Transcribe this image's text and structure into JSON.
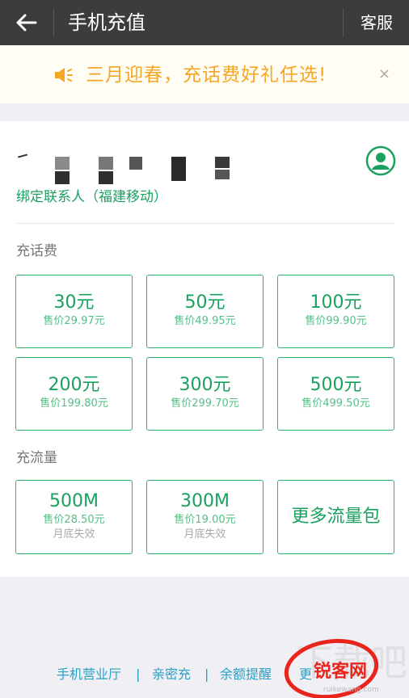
{
  "header": {
    "title": "手机充值",
    "service_label": "客服"
  },
  "notice": {
    "text": "三月迎春，充话费好礼任选!",
    "close": "×"
  },
  "contact": {
    "label": "绑定联系人（福建移动）"
  },
  "recharge": {
    "title": "充话费",
    "items": [
      {
        "amount": "30元",
        "price": "售价29.97元"
      },
      {
        "amount": "50元",
        "price": "售价49.95元"
      },
      {
        "amount": "100元",
        "price": "售价99.90元"
      },
      {
        "amount": "200元",
        "price": "售价199.80元"
      },
      {
        "amount": "300元",
        "price": "售价299.70元"
      },
      {
        "amount": "500元",
        "price": "售价499.50元"
      }
    ]
  },
  "data_plans": {
    "title": "充流量",
    "items": [
      {
        "amount": "500M",
        "price": "售价28.50元",
        "note": "月底失效"
      },
      {
        "amount": "300M",
        "price": "售价19.00元",
        "note": "月底失效"
      }
    ],
    "more_label": "更多流量包"
  },
  "footer": {
    "links": [
      "手机营业厅",
      "亲密充",
      "余额提醒",
      "更"
    ],
    "separator": "|"
  },
  "watermark": {
    "text": "锐客网",
    "url": "ruikewang.com"
  },
  "colors": {
    "green": "#19a15f",
    "orange": "#f5a623",
    "header": "#3c3c3c"
  }
}
